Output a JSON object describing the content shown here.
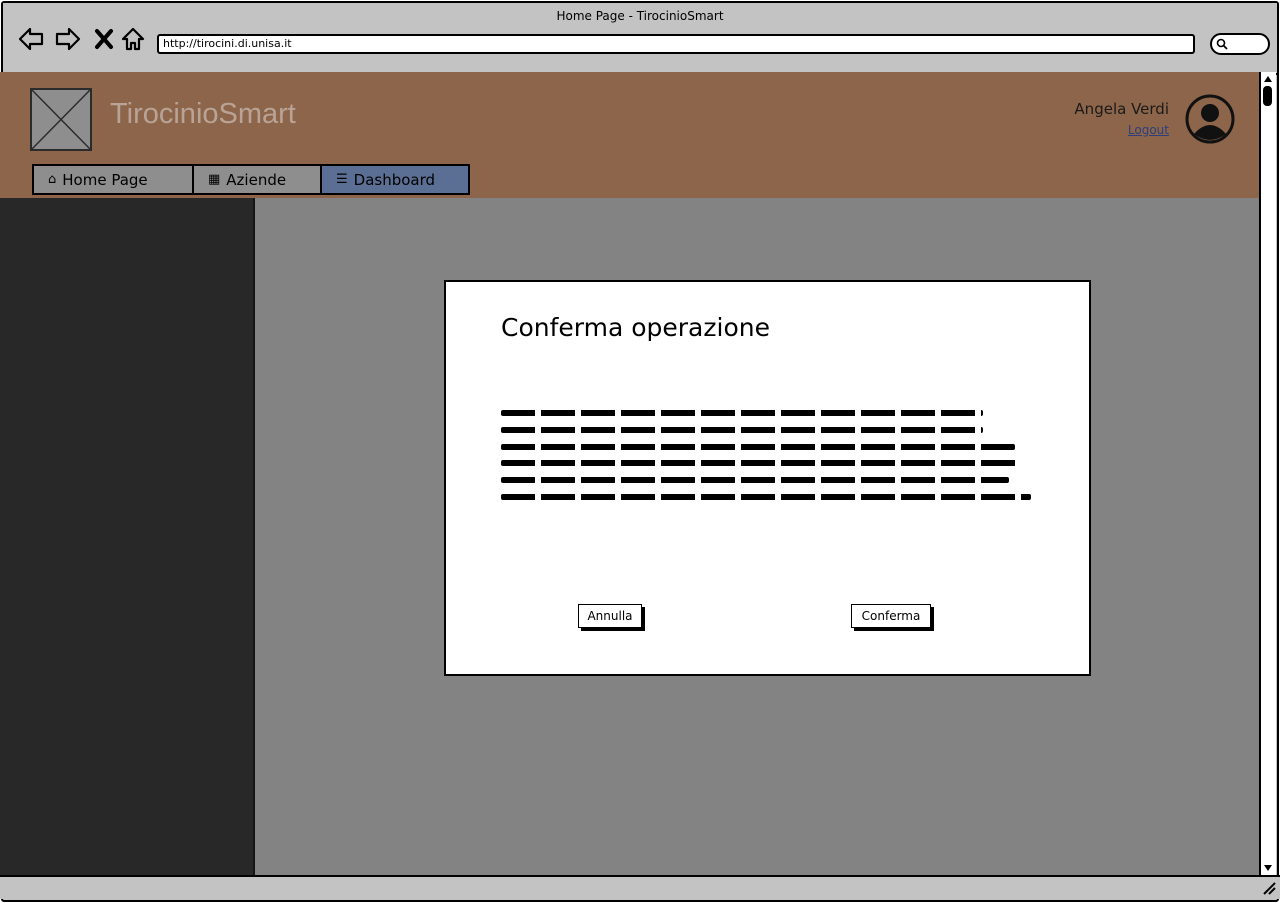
{
  "browser": {
    "window_title": "Home Page - TirocinioSmart",
    "url": "http://tirocini.di.unisa.it"
  },
  "header": {
    "app_name": "TirocinioSmart",
    "user_name": "Angela Verdi",
    "logout_label": "Logout"
  },
  "tabs": [
    {
      "label": "Home Page",
      "icon": "home-icon"
    },
    {
      "label": "Aziende",
      "icon": "building-icon"
    },
    {
      "label": "Dashboard",
      "icon": "list-icon",
      "active": true
    }
  ],
  "modal": {
    "title": "Conferma operazione",
    "cancel_label": "Annulla",
    "confirm_label": "Conferma"
  },
  "colors": {
    "header": "#8d654a",
    "sidebar": "#282828",
    "overlay": "#838383",
    "active_tab": "#5a6f93"
  }
}
